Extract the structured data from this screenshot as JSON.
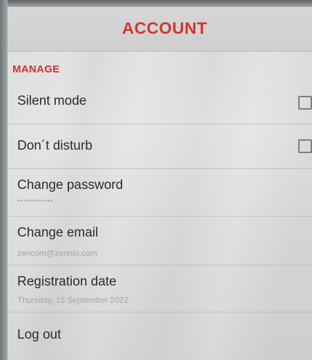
{
  "header": {
    "title": "ACCOUNT"
  },
  "section": {
    "title": "MANAGE"
  },
  "settings": {
    "silent_mode": {
      "label": "Silent mode",
      "checked": false
    },
    "do_not_disturb": {
      "label": "Don´t disturb",
      "checked": false
    },
    "change_password": {
      "label": "Change password",
      "value": "************"
    },
    "change_email": {
      "label": "Change email",
      "value": "zencom@zennio.com"
    },
    "registration_date": {
      "label": "Registration date",
      "value": "Thursday, 15 September 2022"
    },
    "logout": {
      "label": "Log out"
    }
  },
  "colors": {
    "accent": "#d2362f",
    "text": "#2b2b2b",
    "subtext": "#a4a4a4"
  }
}
